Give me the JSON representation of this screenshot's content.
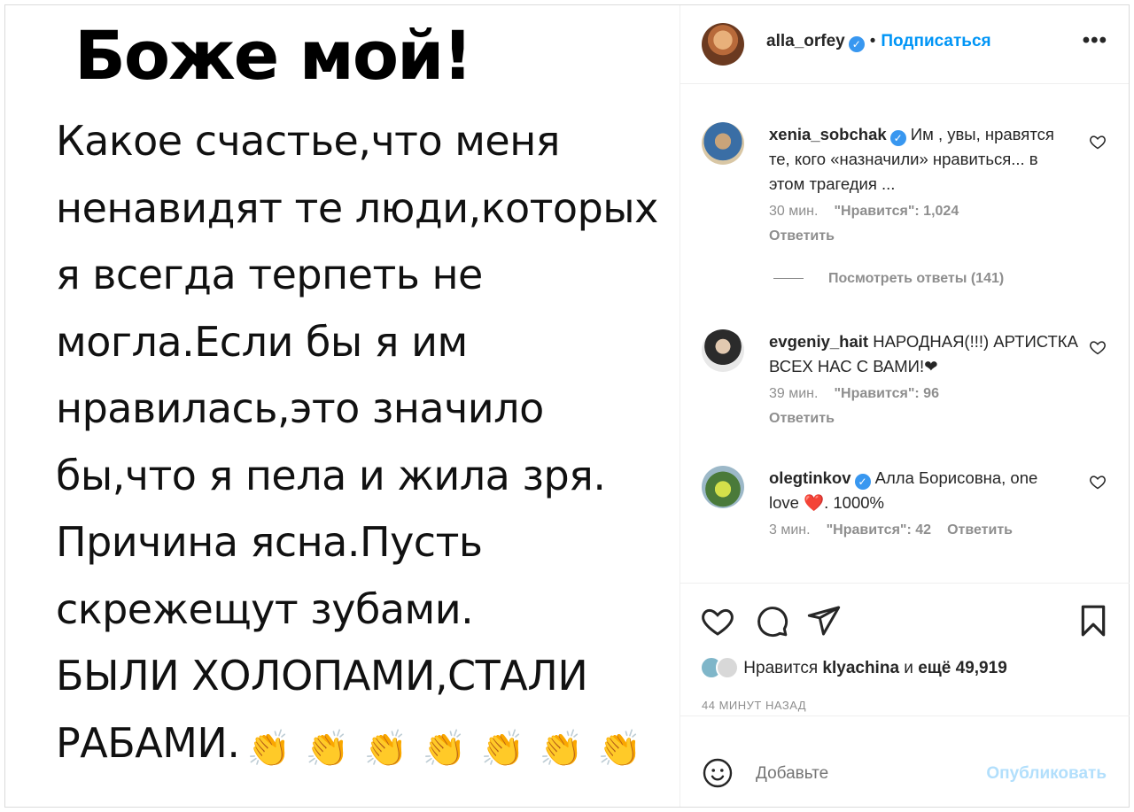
{
  "image": {
    "title": "Боже мой!",
    "lines": [
      "Какое счастье,что меня",
      "ненавидят те люди,которых",
      "я всегда терпеть не",
      "могла.Если бы я им",
      "нравилась,это значило",
      "бы,что я пела и жила зря.",
      "Причина ясна.Пусть",
      "скрежещут зубами.",
      "БЫЛИ ХОЛОПАМИ,СТАЛИ",
      "РАБАМИ."
    ],
    "clap_emoji": "👏"
  },
  "header": {
    "username": "alla_orfey",
    "separator": "•",
    "follow_label": "Подписаться",
    "more_label": "•••"
  },
  "comments": [
    {
      "username": "xenia_sobchak",
      "verified": true,
      "text": "Им , увы, нравятся те, кого «назначили» нравиться... в этом трагедия ...",
      "time": "30 мин.",
      "likes": "\"Нравится\": 1,024",
      "reply": "Ответить"
    },
    {
      "username": "evgeniy_hait",
      "verified": false,
      "text": "НАРОДНАЯ(!!!) АРТИСТКА ВСЕХ НАС С ВАМИ!❤",
      "time": "39 мин.",
      "likes": "\"Нравится\": 96",
      "reply": "Ответить"
    },
    {
      "username": "olegtinkov",
      "verified": true,
      "text": "Алла Борисовна, one love ❤️. 1000%",
      "time": "3 мин.",
      "likes": "\"Нравится\": 42",
      "reply": "Ответить"
    }
  ],
  "view_replies": "Посмотреть ответы (141)",
  "likes": {
    "prefix": "Нравится",
    "user": "klyachina",
    "middle": "и",
    "rest": "ещё 49,919"
  },
  "time_ago": "44 МИНУТ НАЗАД",
  "add_comment": {
    "placeholder": "Добавьте",
    "publish_label": "Опубликовать"
  },
  "colors": {
    "accent": "#0095f6",
    "verified": "#3897f0",
    "muted": "#8e8e8e",
    "publish_disabled": "#b2dffc"
  }
}
